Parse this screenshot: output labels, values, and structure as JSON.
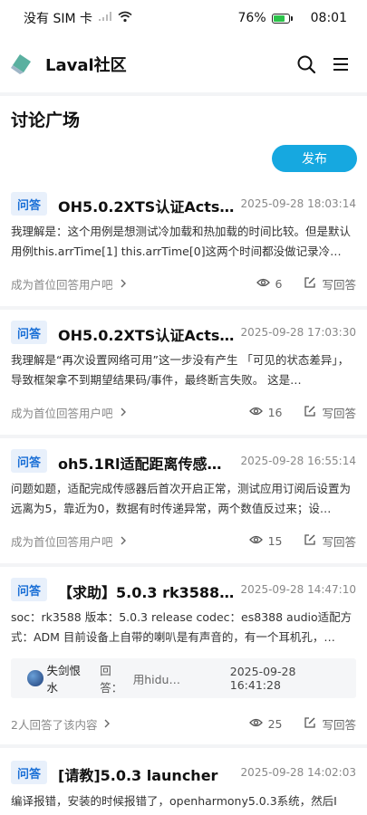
{
  "status": {
    "carrier": "没有 SIM 卡",
    "battery": "76%",
    "battery_level": 0.76,
    "time": "08:01"
  },
  "header": {
    "title": "Laval社区",
    "search_icon": "search-icon",
    "menu_icon": "menu-icon"
  },
  "page": {
    "title": "讨论广场",
    "publish_label": "发布"
  },
  "posts": [
    {
      "tag": "问答",
      "title": "OH5.0.2XTS认证ActsA…",
      "time": "2025-09-28 18:03:14",
      "excerpt": "我理解是：这个用例是想测试冷加载和热加载的时间比较。但是默认用例this.arrTime[1] this.arrTime[0]这两个时间都没做记录冷…",
      "footer": "成为首位回答用户吧",
      "views": "6",
      "answer_label": "写回答"
    },
    {
      "tag": "问答",
      "title": "OH5.0.2XTS认证ActsA…",
      "time": "2025-09-28 17:03:30",
      "excerpt": "我理解是“再次设置网络可用”这一步没有产生 「可见的状态差异」，导致框架拿不到期望结果码/事件，最终断言失败。 这是…",
      "footer": "成为首位回答用户吧",
      "views": "16",
      "answer_label": "写回答"
    },
    {
      "tag": "问答",
      "title": "oh5.1Rl适配距离传感…",
      "time": "2025-09-28 16:55:14",
      "excerpt": "问题如题，适配完成传感器后首次开启正常，测试应用订阅后设置为远离为5，靠近为0，数据有时传递异常，两个数值反过来；设…",
      "footer": "成为首位回答用户吧",
      "views": "15",
      "answer_label": "写回答"
    },
    {
      "tag": "问答",
      "title": "【求助】5.0.3 rk3588 …",
      "time": "2025-09-28 14:47:10",
      "excerpt": "soc：rk3588 版本：5.0.3 release codec：es8388 audio适配方式：ADM 目前设备上自带的喇叭是有声音的，有一个耳机孔，…",
      "reply": {
        "user": "失剑恨水",
        "prefix": "回答：",
        "text": "用hidu…",
        "time": "2025-09-28 16:41:28"
      },
      "footer": "2人回答了该内容",
      "views": "25",
      "answer_label": "写回答"
    },
    {
      "tag": "问答",
      "title": "[请教]5.0.3 launcher",
      "time": "2025-09-28 14:02:03",
      "excerpt": "编译报错，安装的时候报错了，openharmony5.0.3系统，然后I"
    }
  ]
}
